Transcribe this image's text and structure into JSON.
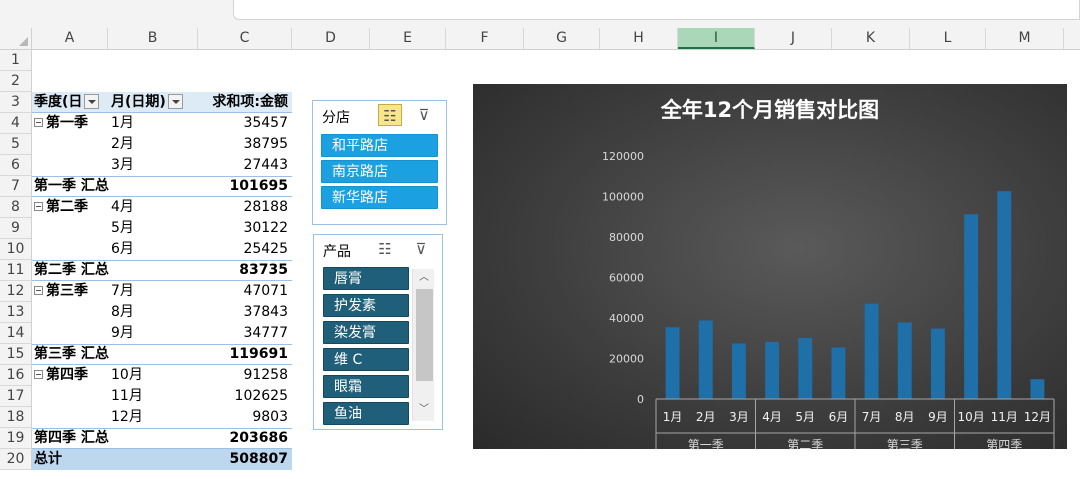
{
  "columns": [
    "A",
    "B",
    "C",
    "D",
    "E",
    "F",
    "G",
    "H",
    "I",
    "J",
    "K",
    "L",
    "M"
  ],
  "selected_column": "I",
  "rows": [
    "1",
    "2",
    "3",
    "4",
    "5",
    "6",
    "7",
    "8",
    "9",
    "10",
    "11",
    "12",
    "13",
    "14",
    "15",
    "16",
    "17",
    "18",
    "19",
    "20"
  ],
  "pivot": {
    "header": {
      "quarter": "季度(日",
      "month": "月(日期)",
      "value": "求和项:金额"
    },
    "groups": [
      {
        "quarter": "第一季",
        "months": [
          {
            "month": "1月",
            "value": "35457"
          },
          {
            "month": "2月",
            "value": "38795"
          },
          {
            "month": "3月",
            "value": "27443"
          }
        ],
        "subtotal_label": "第一季 汇总",
        "subtotal": "101695"
      },
      {
        "quarter": "第二季",
        "months": [
          {
            "month": "4月",
            "value": "28188"
          },
          {
            "month": "5月",
            "value": "30122"
          },
          {
            "month": "6月",
            "value": "25425"
          }
        ],
        "subtotal_label": "第二季 汇总",
        "subtotal": "83735"
      },
      {
        "quarter": "第三季",
        "months": [
          {
            "month": "7月",
            "value": "47071"
          },
          {
            "month": "8月",
            "value": "37843"
          },
          {
            "month": "9月",
            "value": "34777"
          }
        ],
        "subtotal_label": "第三季 汇总",
        "subtotal": "119691"
      },
      {
        "quarter": "第四季",
        "months": [
          {
            "month": "10月",
            "value": "91258"
          },
          {
            "month": "11月",
            "value": "102625"
          },
          {
            "month": "12月",
            "value": "9803"
          }
        ],
        "subtotal_label": "第四季 汇总",
        "subtotal": "203686"
      }
    ],
    "total_label": "总计",
    "total": "508807"
  },
  "slicer_branch": {
    "title": "分店",
    "items": [
      "和平路店",
      "南京路店",
      "新华路店"
    ],
    "multi_select_active": true
  },
  "slicer_product": {
    "title": "产品",
    "items": [
      "唇膏",
      "护发素",
      "染发膏",
      "维 C",
      "眼霜",
      "鱼油"
    ],
    "multi_select_active": false
  },
  "chart_data": {
    "type": "bar",
    "title": "全年12个月销售对比图",
    "categories": [
      "1月",
      "2月",
      "3月",
      "4月",
      "5月",
      "6月",
      "7月",
      "8月",
      "9月",
      "10月",
      "11月",
      "12月"
    ],
    "groups": [
      {
        "name": "第一季",
        "categories": [
          "1月",
          "2月",
          "3月"
        ]
      },
      {
        "name": "第二季",
        "categories": [
          "4月",
          "5月",
          "6月"
        ]
      },
      {
        "name": "第三季",
        "categories": [
          "7月",
          "8月",
          "9月"
        ]
      },
      {
        "name": "第四季",
        "categories": [
          "10月",
          "11月",
          "12月"
        ]
      }
    ],
    "values": [
      35457,
      38795,
      27443,
      28188,
      30122,
      25425,
      47071,
      37843,
      34777,
      91258,
      102625,
      9803
    ],
    "ylim": [
      0,
      120000
    ],
    "yticks": [
      "0",
      "20000",
      "40000",
      "60000",
      "80000",
      "100000",
      "120000"
    ],
    "bar_color": "#1f6fa8",
    "background_color": "#404040",
    "grid": false,
    "legend": "none"
  }
}
